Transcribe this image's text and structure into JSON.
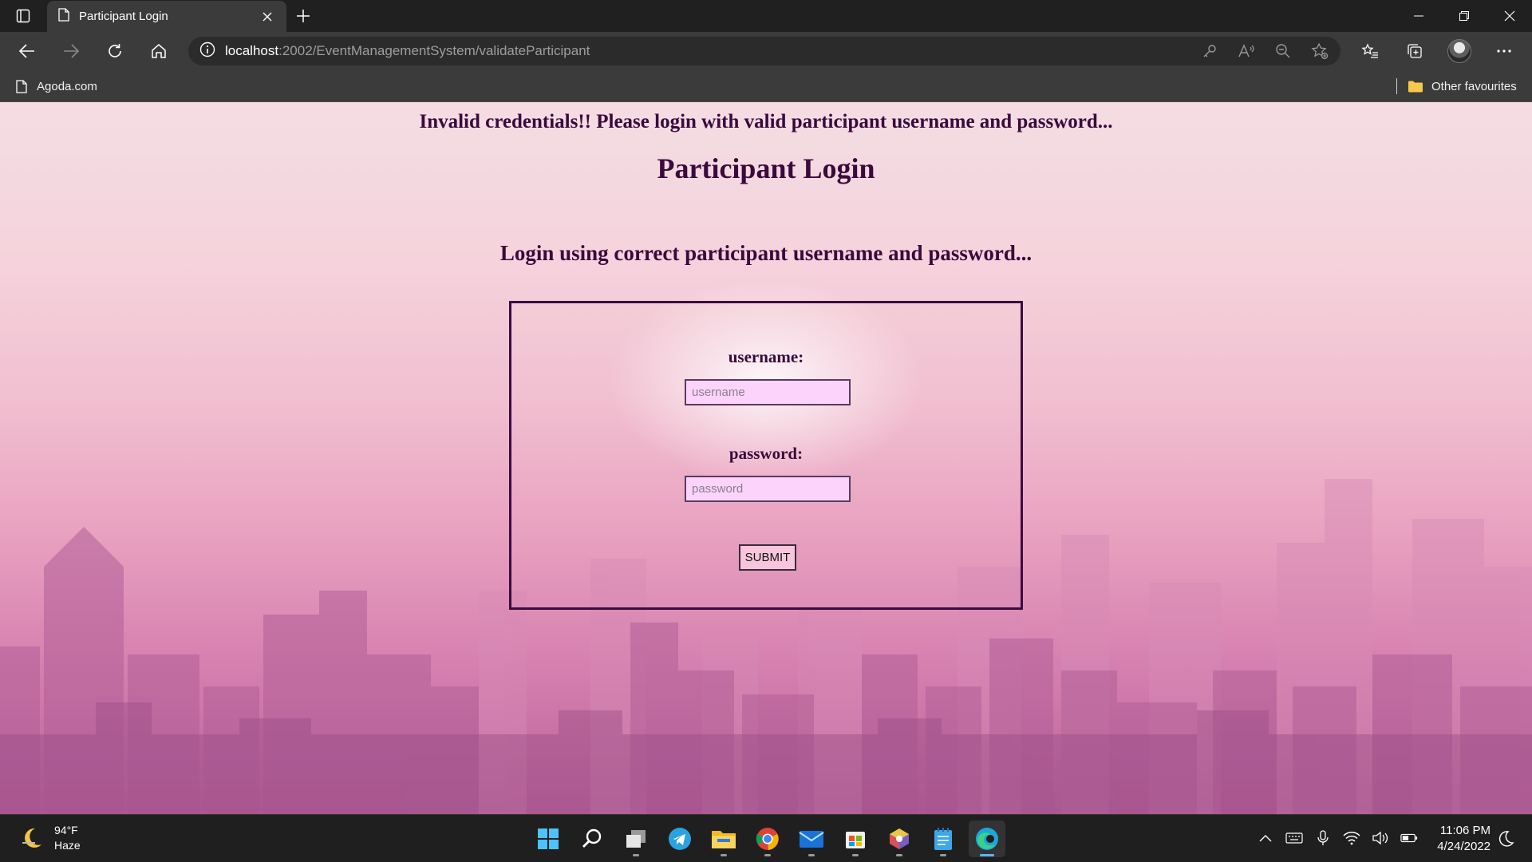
{
  "browser": {
    "tab_title": "Participant Login",
    "url_host": "localhost",
    "url_path": ":2002/EventManagementSystem/validateParticipant",
    "favourites": [
      {
        "label": "Agoda.com"
      }
    ],
    "other_favourites_label": "Other favourites"
  },
  "page": {
    "error_message": "Invalid credentials!! Please login with valid participant username and password...",
    "title": "Participant Login",
    "instruction": "Login using correct participant username and password...",
    "form": {
      "username_label": "username:",
      "username_placeholder": "username",
      "username_value": "",
      "password_label": "password:",
      "password_placeholder": "password",
      "password_value": "",
      "submit_label": "SUBMIT"
    }
  },
  "taskbar": {
    "weather_temp": "94°F",
    "weather_desc": "Haze",
    "time": "11:06 PM",
    "date": "4/24/2022",
    "apps": [
      "start-icon",
      "search-icon",
      "task-view-icon",
      "telegram-icon",
      "file-explorer-icon",
      "chrome-icon",
      "mail-icon",
      "store-icon",
      "dev-app-icon",
      "notepad-icon",
      "edge-icon"
    ]
  },
  "colors": {
    "page_text": "#3a0a3c",
    "input_bg": "#fcd4fb",
    "browser_chrome": "#3b3b3b",
    "taskbar": "#1f1f1f"
  }
}
